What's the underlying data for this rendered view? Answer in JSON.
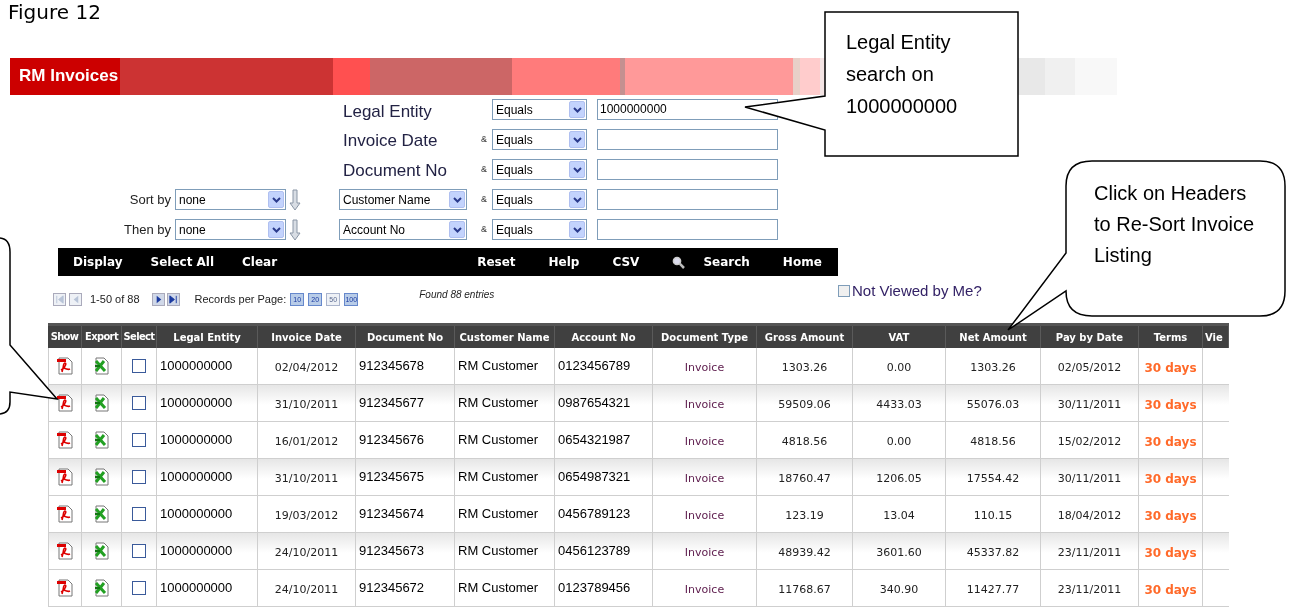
{
  "figure_caption": "Figure 12",
  "app": {
    "title": "RM Invoices",
    "filter_rows": [
      {
        "field": "Legal Entity",
        "kind": "label",
        "connector": null,
        "operator": "Equals",
        "value": "1000000000"
      },
      {
        "field": "Invoice Date",
        "kind": "label",
        "connector": "&",
        "operator": "Equals",
        "value": ""
      },
      {
        "field": "Document No",
        "kind": "label",
        "connector": "&",
        "operator": "Equals",
        "value": ""
      },
      {
        "sort_label": "Sort by",
        "sort_value": "none",
        "field": "Customer Name",
        "kind": "dropdown",
        "connector": "&",
        "operator": "Equals",
        "value": ""
      },
      {
        "sort_label": "Then by",
        "sort_value": "none",
        "field": "Account No",
        "kind": "dropdown",
        "connector": "&",
        "operator": "Equals",
        "value": ""
      }
    ],
    "toolbar": {
      "left": [
        {
          "label": "Display",
          "kind": "button"
        },
        {
          "label": "Select All",
          "kind": "button"
        },
        {
          "label": "Clear",
          "kind": "button"
        }
      ],
      "right": [
        {
          "label": "Reset",
          "kind": "button"
        },
        {
          "label": "Help",
          "kind": "button"
        },
        {
          "label": "CSV",
          "kind": "button"
        },
        {
          "label": "Search",
          "kind": "search"
        },
        {
          "label": "Home",
          "kind": "button"
        }
      ]
    },
    "pagination": {
      "range": "1-50 of 88",
      "records_label": "Records per Page:",
      "page_sizes": [
        {
          "label": "10",
          "selected": false
        },
        {
          "label": "20",
          "selected": false
        },
        {
          "label": "50",
          "selected": true
        },
        {
          "label": "100",
          "selected": false
        }
      ],
      "found": "Found 88 entries"
    },
    "not_viewed": {
      "label": "Not Viewed by Me?",
      "checked": false
    },
    "table": {
      "columns": [
        "Show",
        "Export",
        "Select",
        "Legal Entity",
        "Invoice Date",
        "Document No",
        "Customer Name",
        "Account No",
        "Document Type",
        "Gross Amount",
        "VAT",
        "Net Amount",
        "Pay by Date",
        "Terms",
        "Vie"
      ],
      "rows": [
        {
          "checked": false,
          "legal_entity": "1000000000",
          "invoice_date": "02/04/2012",
          "document_no": "912345678",
          "customer_name": "RM Customer",
          "account_no": "0123456789",
          "document_type": "Invoice",
          "gross_amount": "1303.26",
          "vat": "0.00",
          "net_amount": "1303.26",
          "pay_by_date": "02/05/2012",
          "terms": "30 days"
        },
        {
          "checked": false,
          "legal_entity": "1000000000",
          "invoice_date": "31/10/2011",
          "document_no": "912345677",
          "customer_name": "RM Customer",
          "account_no": "0987654321",
          "document_type": "Invoice",
          "gross_amount": "59509.06",
          "vat": "4433.03",
          "net_amount": "55076.03",
          "pay_by_date": "30/11/2011",
          "terms": "30 days"
        },
        {
          "checked": false,
          "legal_entity": "1000000000",
          "invoice_date": "16/01/2012",
          "document_no": "912345676",
          "customer_name": "RM Customer",
          "account_no": "0654321987",
          "document_type": "Invoice",
          "gross_amount": "4818.56",
          "vat": "0.00",
          "net_amount": "4818.56",
          "pay_by_date": "15/02/2012",
          "terms": "30 days"
        },
        {
          "checked": false,
          "legal_entity": "1000000000",
          "invoice_date": "31/10/2011",
          "document_no": "912345675",
          "customer_name": "RM Customer",
          "account_no": "0654987321",
          "document_type": "Invoice",
          "gross_amount": "18760.47",
          "vat": "1206.05",
          "net_amount": "17554.42",
          "pay_by_date": "30/11/2011",
          "terms": "30 days"
        },
        {
          "checked": false,
          "legal_entity": "1000000000",
          "invoice_date": "19/03/2012",
          "document_no": "912345674",
          "customer_name": "RM Customer",
          "account_no": "0456789123",
          "document_type": "Invoice",
          "gross_amount": "123.19",
          "vat": "13.04",
          "net_amount": "110.15",
          "pay_by_date": "18/04/2012",
          "terms": "30 days"
        },
        {
          "checked": false,
          "legal_entity": "1000000000",
          "invoice_date": "24/10/2011",
          "document_no": "912345673",
          "customer_name": "RM Customer",
          "account_no": "0456123789",
          "document_type": "Invoice",
          "gross_amount": "48939.42",
          "vat": "3601.60",
          "net_amount": "45337.82",
          "pay_by_date": "23/11/2011",
          "terms": "30 days"
        },
        {
          "checked": false,
          "legal_entity": "1000000000",
          "invoice_date": "24/10/2011",
          "document_no": "912345672",
          "customer_name": "RM Customer",
          "account_no": "0123789456",
          "document_type": "Invoice",
          "gross_amount": "11768.67",
          "vat": "340.90",
          "net_amount": "11427.77",
          "pay_by_date": "23/11/2011",
          "terms": "30 days"
        }
      ]
    }
  },
  "callouts": [
    {
      "kind": "rect",
      "text": "Legal Entity search on 1000000000"
    },
    {
      "kind": "rounded",
      "text": "Click on Headers to Re-Sort Invoice Listing"
    },
    {
      "kind": "edge"
    }
  ]
}
